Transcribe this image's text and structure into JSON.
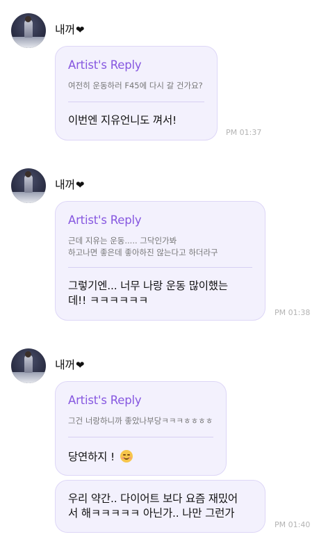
{
  "groups": [
    {
      "sender": "내꺼",
      "reply_title": "Artist's Reply",
      "reply_quote": "여전히 운동하러 F45에 다시 갈 건가요?",
      "message": "이번엔 지유언니도 껴서!",
      "time": "PM 01:37"
    },
    {
      "sender": "내꺼",
      "reply_title": "Artist's Reply",
      "reply_quote": "근데 지유는 운동..... 그닥인가봐\n하고나면 좋은데 좋아하진 않는다고 하더라구",
      "message": "그렇기엔... 너무 나랑 운동 많이했는\n데!! ㅋㅋㅋㅋㅋㅋ",
      "time": "PM 01:38"
    },
    {
      "sender": "내꺼",
      "reply_title": "Artist's Reply",
      "reply_quote": "그건 너랑하니까 좋았나부당ㅋㅋㅋㅎㅎㅎㅎ",
      "message": "당연하지 !",
      "emoji": "smiling-face-icon",
      "followup": "우리 약간.. 다이어트 보다 요즘 재밌어\n서 해ㅋㅋㅋㅋㅋ 아닌가.. 나만 그런가",
      "time": "PM 01:40"
    }
  ],
  "heart": "❤",
  "colors": {
    "accent": "#8657e0",
    "bubble_bg": "#f3f1fd",
    "bubble_border": "#ddd6f7"
  }
}
